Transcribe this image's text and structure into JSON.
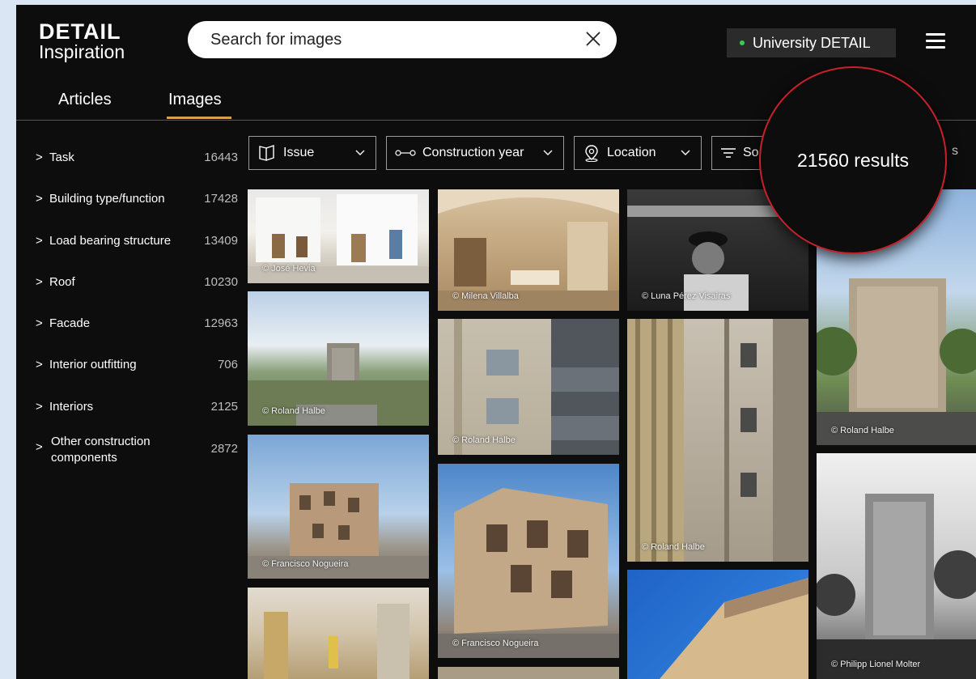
{
  "header": {
    "logo_top": "DETAIL",
    "logo_bottom": "Inspiration",
    "search_placeholder": "Search for images",
    "account_label": "University DETAIL"
  },
  "tabs": [
    {
      "label": "Articles",
      "active": false
    },
    {
      "label": "Images",
      "active": true
    }
  ],
  "sidebar": {
    "categories": [
      {
        "label": "Task",
        "count": "16443"
      },
      {
        "label": "Building type/function",
        "count": "17428"
      },
      {
        "label": "Load bearing structure",
        "count": "13409"
      },
      {
        "label": "Roof",
        "count": "10230"
      },
      {
        "label": "Facade",
        "count": "12963"
      },
      {
        "label": "Interior outfitting",
        "count": "706"
      },
      {
        "label": "Interiors",
        "count": "2125"
      },
      {
        "label": "Other construction components",
        "label_line1": "Other construction",
        "label_line2": "components",
        "count": "2872"
      }
    ]
  },
  "filters": [
    {
      "label": "Issue",
      "icon": "book-icon"
    },
    {
      "label": "Construction year",
      "icon": "timeline-icon"
    },
    {
      "label": "Location",
      "icon": "location-pin-icon"
    },
    {
      "label": "So",
      "icon": "sort-icon"
    }
  ],
  "results": {
    "count_label": "21560 results",
    "trailing_text": "s"
  },
  "images": [
    {
      "credit": "© José Hevia"
    },
    {
      "credit": "© Milena Villalba"
    },
    {
      "credit": "© Luna Pérez Visairas"
    },
    {
      "credit": "© Roland Halbe"
    },
    {
      "credit": "© Roland Halbe"
    },
    {
      "credit": "© Roland Halbe"
    },
    {
      "credit": "© Roland Halbe"
    },
    {
      "credit": "© Francisco Nogueira"
    },
    {
      "credit": "© Francisco Nogueira"
    },
    {
      "credit": "© Philipp Lionel Molter"
    },
    {
      "credit": ""
    },
    {
      "credit": ""
    }
  ],
  "colors": {
    "accent_underline": "#d4a24a",
    "status_dot": "#35d04d",
    "highlight_ring": "#c8202a"
  }
}
